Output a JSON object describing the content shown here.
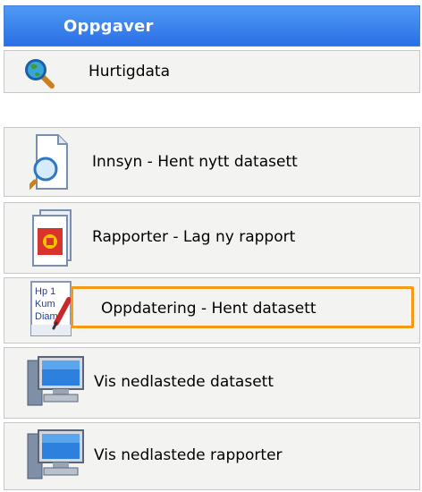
{
  "panel": {
    "title": "Oppgaver"
  },
  "items": [
    {
      "id": "hurtigdata",
      "label": "Hurtigdata",
      "icon": "magnifier-globe-icon"
    },
    {
      "id": "innsyn",
      "label": "Innsyn - Hent nytt datasett",
      "icon": "document-magnifier-icon"
    },
    {
      "id": "rapporter",
      "label": "Rapporter - Lag ny rapport",
      "icon": "report-emblem-icon"
    },
    {
      "id": "oppdatering",
      "label": "Oppdatering - Hent datasett",
      "icon": "edit-document-pencil-icon",
      "doc_lines": [
        "Hp 1",
        "Kum",
        "Diam"
      ]
    },
    {
      "id": "vis-datasett",
      "label": "Vis nedlastede datasett",
      "icon": "computer-icon"
    },
    {
      "id": "vis-rapporter",
      "label": "Vis nedlastede rapporter",
      "icon": "computer-icon"
    }
  ],
  "colors": {
    "header": "#2b6fe6",
    "highlight": "#f39a17"
  }
}
